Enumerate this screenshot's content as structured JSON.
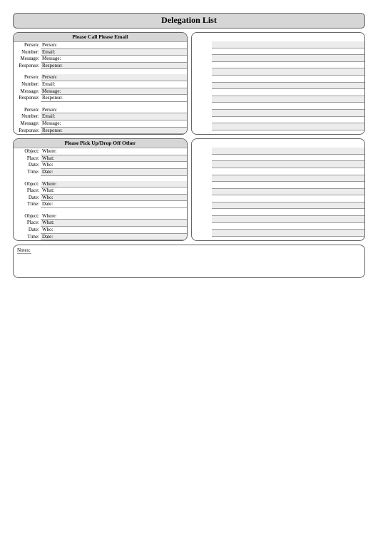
{
  "title": "Delegation List",
  "panel1": {
    "heading": "Please Call Please Email",
    "labels": {
      "person": "Person:",
      "number": "Number:",
      "message": "Message:",
      "response": "Response:",
      "email": "Email:"
    }
  },
  "panel2": {
    "heading": "Please Pick Up/Drop Off Other",
    "labels": {
      "object": "Object:",
      "place": "Place:",
      "date": "Date:",
      "time": "Time:",
      "where": "Where:",
      "what": "What:",
      "who": "Who:"
    }
  },
  "notes": "Notes:"
}
